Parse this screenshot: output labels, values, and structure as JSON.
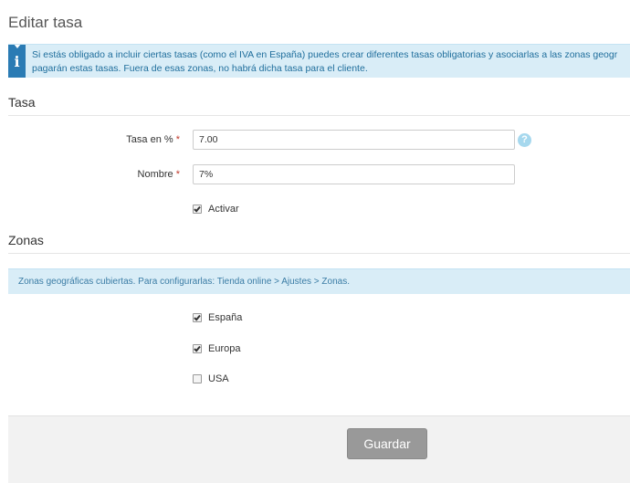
{
  "page": {
    "title": "Editar tasa"
  },
  "info": {
    "text_line1": "Si estás obligado a incluir ciertas tasas (como el IVA en España) puedes crear diferentes tasas obligatorias y asociarlas a las zonas geogr",
    "text_line2": "pagarán estas tasas. Fuera de esas zonas, no habrá dicha tasa para el cliente."
  },
  "tasa_section": {
    "title": "Tasa",
    "rate_label": "Tasa en %",
    "rate_value": "7.00",
    "name_label": "Nombre",
    "name_value": "7%",
    "required_mark": "*",
    "help_glyph": "?",
    "activate_label": "Activar",
    "activate_checked": true
  },
  "zonas_section": {
    "title": "Zonas",
    "notice": "Zonas geográficas cubiertas. Para configurarlas: Tienda online > Ajustes > Zonas.",
    "zones": [
      {
        "label": "España",
        "checked": true
      },
      {
        "label": "Europa",
        "checked": true
      },
      {
        "label": "USA",
        "checked": false
      }
    ]
  },
  "footer": {
    "save_label": "Guardar"
  },
  "icons": {
    "info": "info-icon",
    "help": "help-icon"
  },
  "colors": {
    "alert_bg": "#d9edf7",
    "alert_text": "#1f6e9c",
    "icon_blue": "#2a7bb4",
    "button_gray": "#999999"
  }
}
